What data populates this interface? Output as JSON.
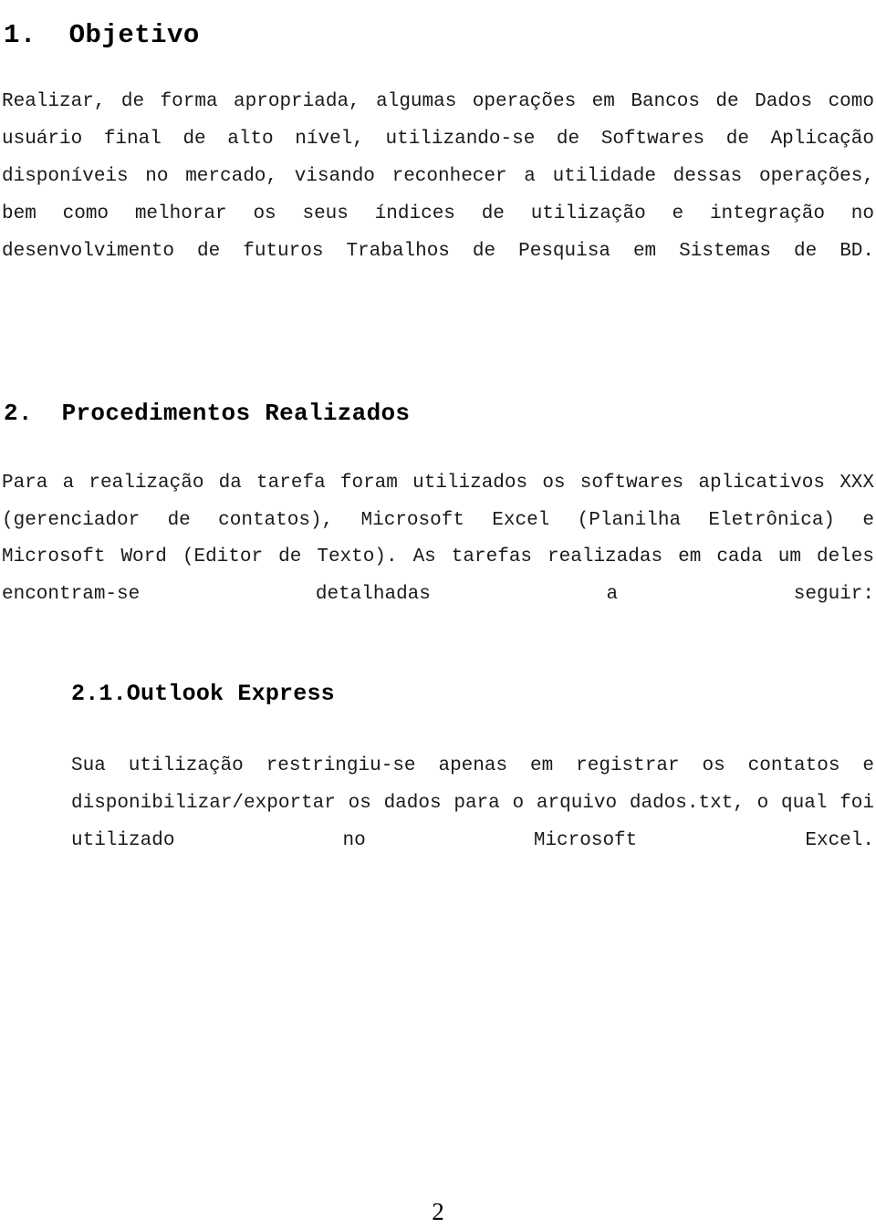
{
  "document": {
    "language": "pt-BR",
    "page_number": "2",
    "background_color": "#ffffff",
    "text_color": "#000000"
  },
  "sections": [
    {
      "number": "1.",
      "heading": "1.  Objetivo",
      "title": "Objetivo",
      "body": "Realizar, de forma apropriada, algumas operações em Bancos de Dados como usuário final de alto nível, utilizando-se de Softwares de Aplicação disponíveis no mercado, visando reconhecer a utilidade dessas operações, bem como melhorar os seus índices de utilização e integração no desenvolvimento de futuros Trabalhos de Pesquisa em Sistemas de BD."
    },
    {
      "number": "2.",
      "heading": "2.  Procedimentos Realizados",
      "title": "Procedimentos Realizados",
      "body": "Para a realização da tarefa foram utilizados os softwares aplicativos XXX (gerenciador de contatos), Microsoft Excel (Planilha Eletrônica) e Microsoft Word (Editor de Texto). As tarefas realizadas em cada um deles encontram-se detalhadas a seguir:",
      "subsections": [
        {
          "number": "2.1.",
          "heading": "2.1.Outlook Express",
          "title": "Outlook Express",
          "body": "Sua utilização restringiu-se apenas em registrar os contatos e disponibilizar/exportar os dados para o arquivo dados.txt, o qual foi utilizado no Microsoft Excel."
        }
      ]
    }
  ]
}
